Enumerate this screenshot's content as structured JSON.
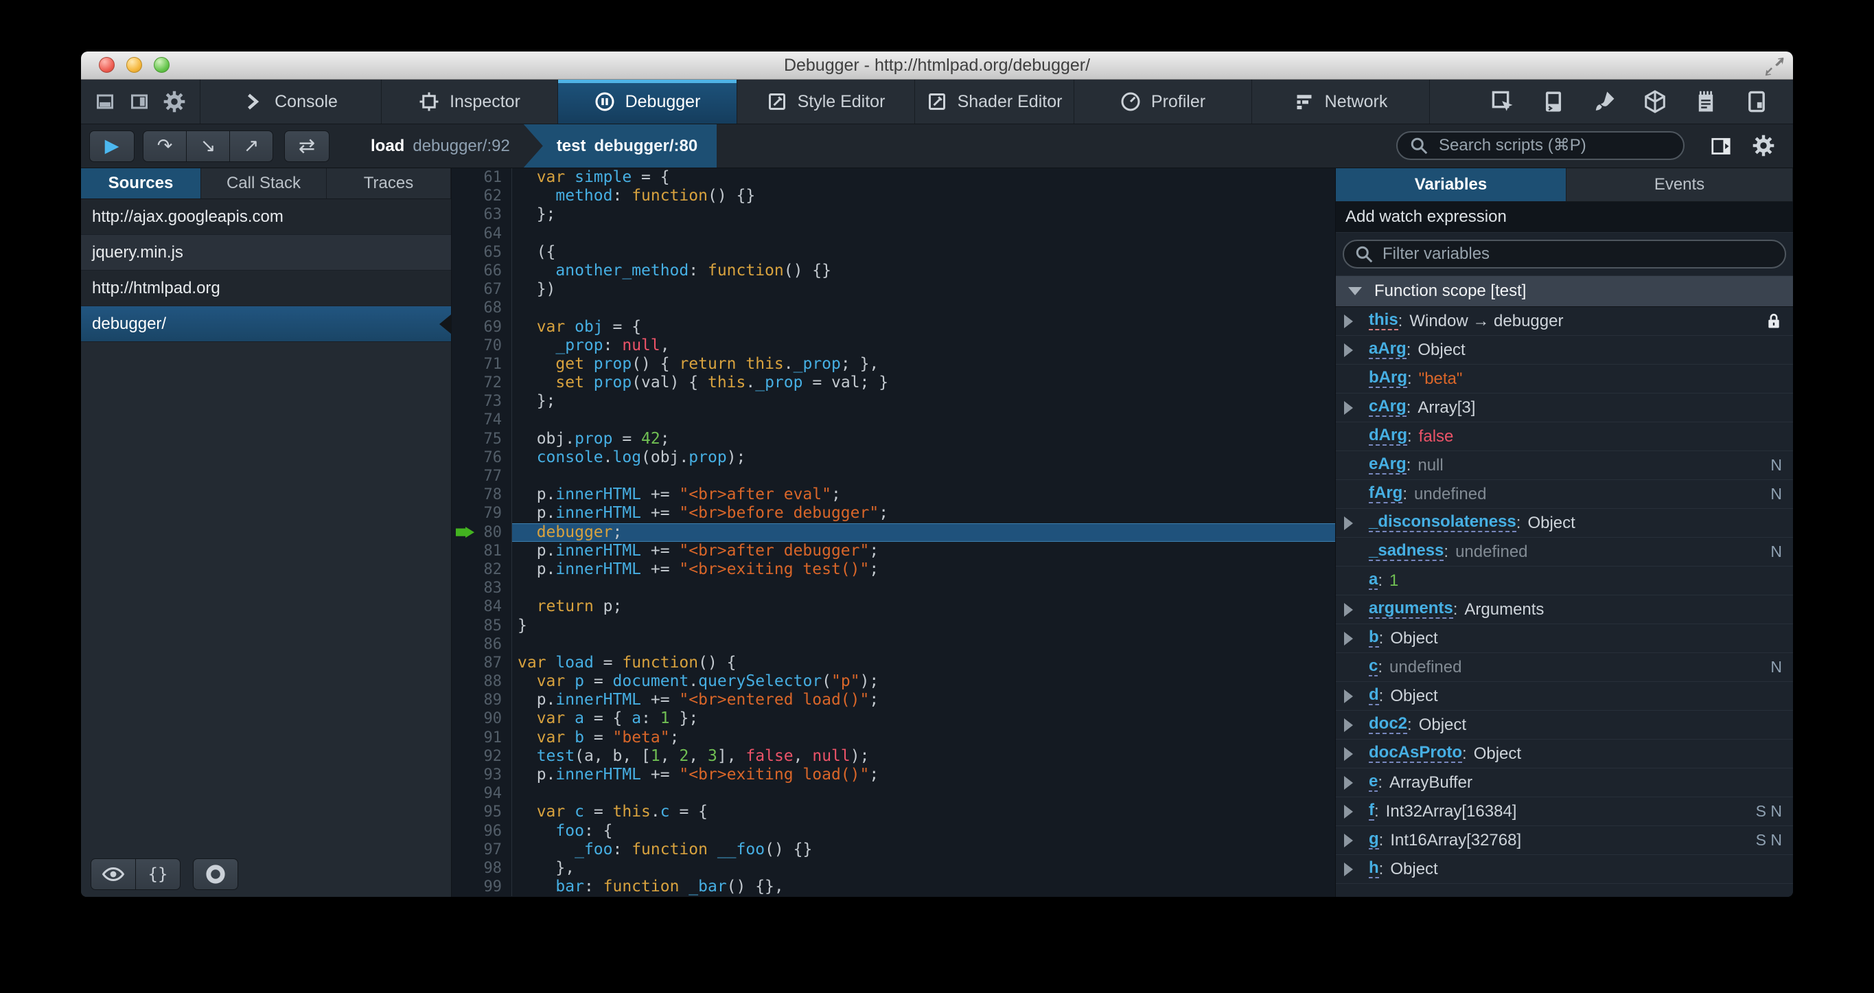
{
  "titlebar": {
    "title": "Debugger - http://htmlpad.org/debugger/"
  },
  "main_tabs": {
    "selected": "Debugger",
    "items": [
      {
        "label": "Console"
      },
      {
        "label": "Inspector"
      },
      {
        "label": "Debugger"
      },
      {
        "label": "Style Editor"
      },
      {
        "label": "Shader Editor"
      },
      {
        "label": "Profiler"
      },
      {
        "label": "Network"
      }
    ]
  },
  "toolbar": {
    "breadcrumbs": [
      {
        "fn": "load",
        "loc": "debugger/:92",
        "selected": false
      },
      {
        "fn": "test",
        "loc": "debugger/:80",
        "selected": true
      }
    ],
    "search_placeholder": "Search scripts (⌘P)"
  },
  "sources": {
    "tabs": [
      "Sources",
      "Call Stack",
      "Traces"
    ],
    "selected_tab": "Sources",
    "items": [
      {
        "label": "http://ajax.googleapis.com",
        "kind": "group",
        "selected": false
      },
      {
        "label": "jquery.min.js",
        "kind": "file",
        "selected": false
      },
      {
        "label": "http://htmlpad.org",
        "kind": "group",
        "selected": false
      },
      {
        "label": "debugger/",
        "kind": "file",
        "selected": true
      }
    ]
  },
  "editor": {
    "current_line": 80,
    "lines": [
      {
        "n": 61,
        "seg": [
          [
            "p",
            "  "
          ],
          [
            "k",
            "var"
          ],
          [
            "p",
            " "
          ],
          [
            "v",
            "simple"
          ],
          [
            "p",
            " = {"
          ]
        ]
      },
      {
        "n": 62,
        "seg": [
          [
            "p",
            "    "
          ],
          [
            "v",
            "method"
          ],
          [
            "p",
            ": "
          ],
          [
            "k",
            "function"
          ],
          [
            "p",
            "() {}"
          ]
        ]
      },
      {
        "n": 63,
        "seg": [
          [
            "p",
            "  };"
          ]
        ]
      },
      {
        "n": 64,
        "seg": []
      },
      {
        "n": 65,
        "seg": [
          [
            "p",
            "  ({"
          ]
        ]
      },
      {
        "n": 66,
        "seg": [
          [
            "p",
            "    "
          ],
          [
            "v",
            "another_method"
          ],
          [
            "p",
            ": "
          ],
          [
            "k",
            "function"
          ],
          [
            "p",
            "() {}"
          ]
        ]
      },
      {
        "n": 67,
        "seg": [
          [
            "p",
            "  })"
          ]
        ]
      },
      {
        "n": 68,
        "seg": []
      },
      {
        "n": 69,
        "seg": [
          [
            "p",
            "  "
          ],
          [
            "k",
            "var"
          ],
          [
            "p",
            " "
          ],
          [
            "v",
            "obj"
          ],
          [
            "p",
            " = {"
          ]
        ]
      },
      {
        "n": 70,
        "seg": [
          [
            "p",
            "    "
          ],
          [
            "v",
            "_prop"
          ],
          [
            "p",
            ": "
          ],
          [
            "a",
            "null"
          ],
          [
            "p",
            ","
          ]
        ]
      },
      {
        "n": 71,
        "seg": [
          [
            "p",
            "    "
          ],
          [
            "k",
            "get"
          ],
          [
            "p",
            " "
          ],
          [
            "v",
            "prop"
          ],
          [
            "p",
            "() { "
          ],
          [
            "k",
            "return"
          ],
          [
            "p",
            " "
          ],
          [
            "k",
            "this"
          ],
          [
            "p",
            "."
          ],
          [
            "v",
            "_prop"
          ],
          [
            "p",
            "; },"
          ]
        ]
      },
      {
        "n": 72,
        "seg": [
          [
            "p",
            "    "
          ],
          [
            "k",
            "set"
          ],
          [
            "p",
            " "
          ],
          [
            "v",
            "prop"
          ],
          [
            "p",
            "(val) { "
          ],
          [
            "k",
            "this"
          ],
          [
            "p",
            "."
          ],
          [
            "v",
            "_prop"
          ],
          [
            "p",
            " = val; }"
          ]
        ]
      },
      {
        "n": 73,
        "seg": [
          [
            "p",
            "  };"
          ]
        ]
      },
      {
        "n": 74,
        "seg": []
      },
      {
        "n": 75,
        "seg": [
          [
            "p",
            "  obj."
          ],
          [
            "v",
            "prop"
          ],
          [
            "p",
            " = "
          ],
          [
            "n",
            "42"
          ],
          [
            "p",
            ";"
          ]
        ]
      },
      {
        "n": 76,
        "seg": [
          [
            "p",
            "  "
          ],
          [
            "v",
            "console"
          ],
          [
            "p",
            "."
          ],
          [
            "v",
            "log"
          ],
          [
            "p",
            "(obj."
          ],
          [
            "v",
            "prop"
          ],
          [
            "p",
            ");"
          ]
        ]
      },
      {
        "n": 77,
        "seg": []
      },
      {
        "n": 78,
        "seg": [
          [
            "p",
            "  p."
          ],
          [
            "v",
            "innerHTML"
          ],
          [
            "p",
            " += "
          ],
          [
            "s",
            "\"<br>after eval\""
          ],
          [
            "p",
            ";"
          ]
        ]
      },
      {
        "n": 79,
        "seg": [
          [
            "p",
            "  p."
          ],
          [
            "v",
            "innerHTML"
          ],
          [
            "p",
            " += "
          ],
          [
            "s",
            "\"<br>before debugger\""
          ],
          [
            "p",
            ";"
          ]
        ]
      },
      {
        "n": 80,
        "seg": [
          [
            "p",
            "  "
          ],
          [
            "k",
            "debugger"
          ],
          [
            "p",
            ";"
          ]
        ]
      },
      {
        "n": 81,
        "seg": [
          [
            "p",
            "  p."
          ],
          [
            "v",
            "innerHTML"
          ],
          [
            "p",
            " += "
          ],
          [
            "s",
            "\"<br>after debugger\""
          ],
          [
            "p",
            ";"
          ]
        ]
      },
      {
        "n": 82,
        "seg": [
          [
            "p",
            "  p."
          ],
          [
            "v",
            "innerHTML"
          ],
          [
            "p",
            " += "
          ],
          [
            "s",
            "\"<br>exiting test()\""
          ],
          [
            "p",
            ";"
          ]
        ]
      },
      {
        "n": 83,
        "seg": []
      },
      {
        "n": 84,
        "seg": [
          [
            "p",
            "  "
          ],
          [
            "k",
            "return"
          ],
          [
            "p",
            " p;"
          ]
        ]
      },
      {
        "n": 85,
        "seg": [
          [
            "p",
            "}"
          ]
        ]
      },
      {
        "n": 86,
        "seg": []
      },
      {
        "n": 87,
        "seg": [
          [
            "k",
            "var"
          ],
          [
            "p",
            " "
          ],
          [
            "v",
            "load"
          ],
          [
            "p",
            " = "
          ],
          [
            "k",
            "function"
          ],
          [
            "p",
            "() {"
          ]
        ]
      },
      {
        "n": 88,
        "seg": [
          [
            "p",
            "  "
          ],
          [
            "k",
            "var"
          ],
          [
            "p",
            " "
          ],
          [
            "v",
            "p"
          ],
          [
            "p",
            " = "
          ],
          [
            "v",
            "document"
          ],
          [
            "p",
            "."
          ],
          [
            "v",
            "querySelector"
          ],
          [
            "p",
            "("
          ],
          [
            "s",
            "\"p\""
          ],
          [
            "p",
            ");"
          ]
        ]
      },
      {
        "n": 89,
        "seg": [
          [
            "p",
            "  p."
          ],
          [
            "v",
            "innerHTML"
          ],
          [
            "p",
            " += "
          ],
          [
            "s",
            "\"<br>entered load()\""
          ],
          [
            "p",
            ";"
          ]
        ]
      },
      {
        "n": 90,
        "seg": [
          [
            "p",
            "  "
          ],
          [
            "k",
            "var"
          ],
          [
            "p",
            " "
          ],
          [
            "v",
            "a"
          ],
          [
            "p",
            " = { "
          ],
          [
            "v",
            "a"
          ],
          [
            "p",
            ": "
          ],
          [
            "n",
            "1"
          ],
          [
            "p",
            " };"
          ]
        ]
      },
      {
        "n": 91,
        "seg": [
          [
            "p",
            "  "
          ],
          [
            "k",
            "var"
          ],
          [
            "p",
            " "
          ],
          [
            "v",
            "b"
          ],
          [
            "p",
            " = "
          ],
          [
            "s",
            "\"beta\""
          ],
          [
            "p",
            ";"
          ]
        ]
      },
      {
        "n": 92,
        "seg": [
          [
            "p",
            "  "
          ],
          [
            "v",
            "test"
          ],
          [
            "p",
            "(a, b, ["
          ],
          [
            "n",
            "1"
          ],
          [
            "p",
            ", "
          ],
          [
            "n",
            "2"
          ],
          [
            "p",
            ", "
          ],
          [
            "n",
            "3"
          ],
          [
            "p",
            "], "
          ],
          [
            "a",
            "false"
          ],
          [
            "p",
            ", "
          ],
          [
            "a",
            "null"
          ],
          [
            "p",
            ");"
          ]
        ]
      },
      {
        "n": 93,
        "seg": [
          [
            "p",
            "  p."
          ],
          [
            "v",
            "innerHTML"
          ],
          [
            "p",
            " += "
          ],
          [
            "s",
            "\"<br>exiting load()\""
          ],
          [
            "p",
            ";"
          ]
        ]
      },
      {
        "n": 94,
        "seg": []
      },
      {
        "n": 95,
        "seg": [
          [
            "p",
            "  "
          ],
          [
            "k",
            "var"
          ],
          [
            "p",
            " "
          ],
          [
            "v",
            "c"
          ],
          [
            "p",
            " = "
          ],
          [
            "k",
            "this"
          ],
          [
            "p",
            "."
          ],
          [
            "v",
            "c"
          ],
          [
            "p",
            " = {"
          ]
        ]
      },
      {
        "n": 96,
        "seg": [
          [
            "p",
            "    "
          ],
          [
            "v",
            "foo"
          ],
          [
            "p",
            ": {"
          ]
        ]
      },
      {
        "n": 97,
        "seg": [
          [
            "p",
            "      "
          ],
          [
            "v",
            "_foo"
          ],
          [
            "p",
            ": "
          ],
          [
            "k",
            "function"
          ],
          [
            "p",
            " "
          ],
          [
            "v",
            "__foo"
          ],
          [
            "p",
            "() {}"
          ]
        ]
      },
      {
        "n": 98,
        "seg": [
          [
            "p",
            "    },"
          ]
        ]
      },
      {
        "n": 99,
        "seg": [
          [
            "p",
            "    "
          ],
          [
            "v",
            "bar"
          ],
          [
            "p",
            ": "
          ],
          [
            "k",
            "function"
          ],
          [
            "p",
            " "
          ],
          [
            "v",
            "_bar"
          ],
          [
            "p",
            "() {},"
          ]
        ]
      }
    ]
  },
  "variables_panel": {
    "tabs": [
      "Variables",
      "Events"
    ],
    "selected_tab": "Variables",
    "watch_label": "Add watch expression",
    "filter_placeholder": "Filter variables",
    "scope_title": "Function scope [test]",
    "rows": [
      {
        "expand": true,
        "name": "this",
        "pink": true,
        "value": "Window → debugger",
        "vclass": "plain",
        "lock": true
      },
      {
        "expand": true,
        "name": "aArg",
        "value": "Object",
        "vclass": "plain"
      },
      {
        "expand": false,
        "name": "bArg",
        "value": "\"beta\"",
        "vclass": "string"
      },
      {
        "expand": true,
        "name": "cArg",
        "value": "Array[3]",
        "vclass": "plain"
      },
      {
        "expand": false,
        "name": "dArg",
        "value": "false",
        "vclass": "atom"
      },
      {
        "expand": false,
        "name": "eArg",
        "value": "null",
        "vclass": "muted",
        "badge": "N"
      },
      {
        "expand": false,
        "name": "fArg",
        "value": "undefined",
        "vclass": "muted",
        "badge": "N"
      },
      {
        "expand": true,
        "name": "_disconsolateness",
        "value": "Object",
        "vclass": "plain"
      },
      {
        "expand": false,
        "name": "_sadness",
        "value": "undefined",
        "vclass": "muted",
        "badge": "N"
      },
      {
        "expand": false,
        "name": "a",
        "value": "1",
        "vclass": "number"
      },
      {
        "expand": true,
        "name": "arguments",
        "value": "Arguments",
        "vclass": "plain"
      },
      {
        "expand": true,
        "name": "b",
        "value": "Object",
        "vclass": "plain"
      },
      {
        "expand": false,
        "name": "c",
        "value": "undefined",
        "vclass": "muted",
        "badge": "N"
      },
      {
        "expand": true,
        "name": "d",
        "value": "Object",
        "vclass": "plain"
      },
      {
        "expand": true,
        "name": "doc2",
        "value": "Object",
        "vclass": "plain"
      },
      {
        "expand": true,
        "name": "docAsProto",
        "value": "Object",
        "vclass": "plain"
      },
      {
        "expand": true,
        "name": "e",
        "value": "ArrayBuffer",
        "vclass": "plain"
      },
      {
        "expand": true,
        "name": "f",
        "value": "Int32Array[16384]",
        "vclass": "plain",
        "badge": "S N"
      },
      {
        "expand": true,
        "name": "g",
        "value": "Int16Array[32768]",
        "vclass": "plain",
        "badge": "S N"
      },
      {
        "expand": true,
        "name": "h",
        "value": "Object",
        "vclass": "plain"
      }
    ]
  },
  "colors": {
    "accent_blue": "#46afe3",
    "selection_blue": "#1d4f73",
    "keyword_orange": "#d8a23e",
    "string_orange": "#d96629",
    "number_green": "#70bf53",
    "atom_red": "#eb5368"
  }
}
